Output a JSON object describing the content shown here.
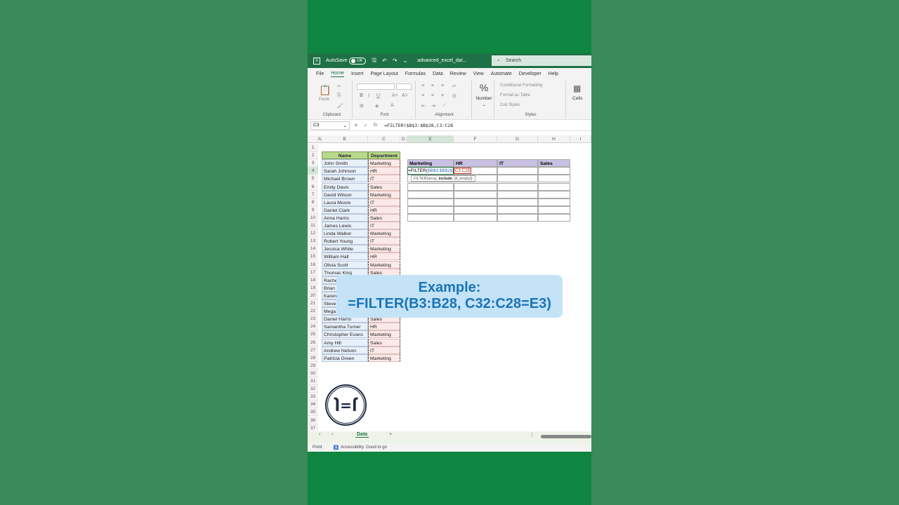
{
  "titlebar": {
    "autosave_label": "AutoSave",
    "autosave_state": "Off",
    "filename": "advanced_excel_dat...",
    "search_placeholder": "Search"
  },
  "menu": [
    "File",
    "Home",
    "Insert",
    "Page Layout",
    "Formulas",
    "Data",
    "Review",
    "View",
    "Automate",
    "Developer",
    "Help"
  ],
  "ribbon": {
    "clipboard": "Clipboard",
    "paste": "Paste",
    "font": "Font",
    "alignment": "Alignment",
    "number": "Number",
    "conditional": "Conditional Formatting",
    "format_table": "Format as Table",
    "cell_styles": "Cell Styles",
    "styles": "Styles",
    "cells": "Cells"
  },
  "formula_bar": {
    "name_box": "C3",
    "formula": "=FILTER($B$3:$B$28,C3:C28"
  },
  "columns": [
    "A",
    "B",
    "C",
    "D",
    "E",
    "F",
    "G",
    "H",
    "I"
  ],
  "rows": [
    "1",
    "2",
    "3",
    "4",
    "5",
    "6",
    "7",
    "8",
    "9",
    "10",
    "11",
    "12",
    "13",
    "14",
    "15",
    "16",
    "17",
    "18",
    "19",
    "20",
    "21",
    "22",
    "23",
    "24",
    "25",
    "26",
    "27",
    "28",
    "29",
    "30",
    "31",
    "32",
    "33",
    "34",
    "35",
    "36",
    "37"
  ],
  "table_headers": {
    "name": "Name",
    "department": "Department"
  },
  "names": [
    "John Smith",
    "Sarah Johnson",
    "Michael Brown",
    "Emily Davis",
    "David Wilson",
    "Laura Moore",
    "Daniel Clark",
    "Anna Harris",
    "James Lewis",
    "Linda Walker",
    "Robert Young",
    "Jessica White",
    "William Hall",
    "Olivia Scott",
    "Thomas King",
    "Rache",
    "Brian",
    "Karen",
    "Steve",
    "Mega",
    "Daniel Harris",
    "Samantha Turner",
    "Christopher Evans",
    "Amy Hill",
    "Andrew Nelson",
    "Patricia Green"
  ],
  "departments": [
    "Marketing",
    "HR",
    "IT",
    "Sales",
    "Marketing",
    "IT",
    "HR",
    "Sales",
    "IT",
    "Marketing",
    "IT",
    "Marketing",
    "HR",
    "Marketing",
    "Sales",
    "",
    "",
    "",
    "",
    "",
    "Sales",
    "HR",
    "Marketing",
    "Sales",
    "IT",
    "Marketing"
  ],
  "filter_headers": [
    "Marketing",
    "HR",
    "IT",
    "Sales"
  ],
  "editing_cell": {
    "prefix": "=FILTER(",
    "range1": "$B$3:$B$28",
    "comma": ",",
    "range2": "C3:C28"
  },
  "tooltip": {
    "prefix": "FILTER(array, ",
    "bold": "include",
    "suffix": ", [if_empty])"
  },
  "example": {
    "line1": "Example:",
    "line2": "=FILTER(B3:B28, C32:C28=E3)"
  },
  "logo_text": "J=Γ",
  "sheet_tab": "Data",
  "status": {
    "mode": "Point",
    "accessibility": "Accessibility: Good to go"
  },
  "colors": {
    "excel_green": "#1e7145",
    "header_green": "#b8d98c",
    "name_fill": "#e8f0fa",
    "dept_fill": "#fbe9e7",
    "filter_header": "#c8c1e3",
    "example_bg": "#c4e3f7",
    "example_text": "#1a74b8"
  }
}
